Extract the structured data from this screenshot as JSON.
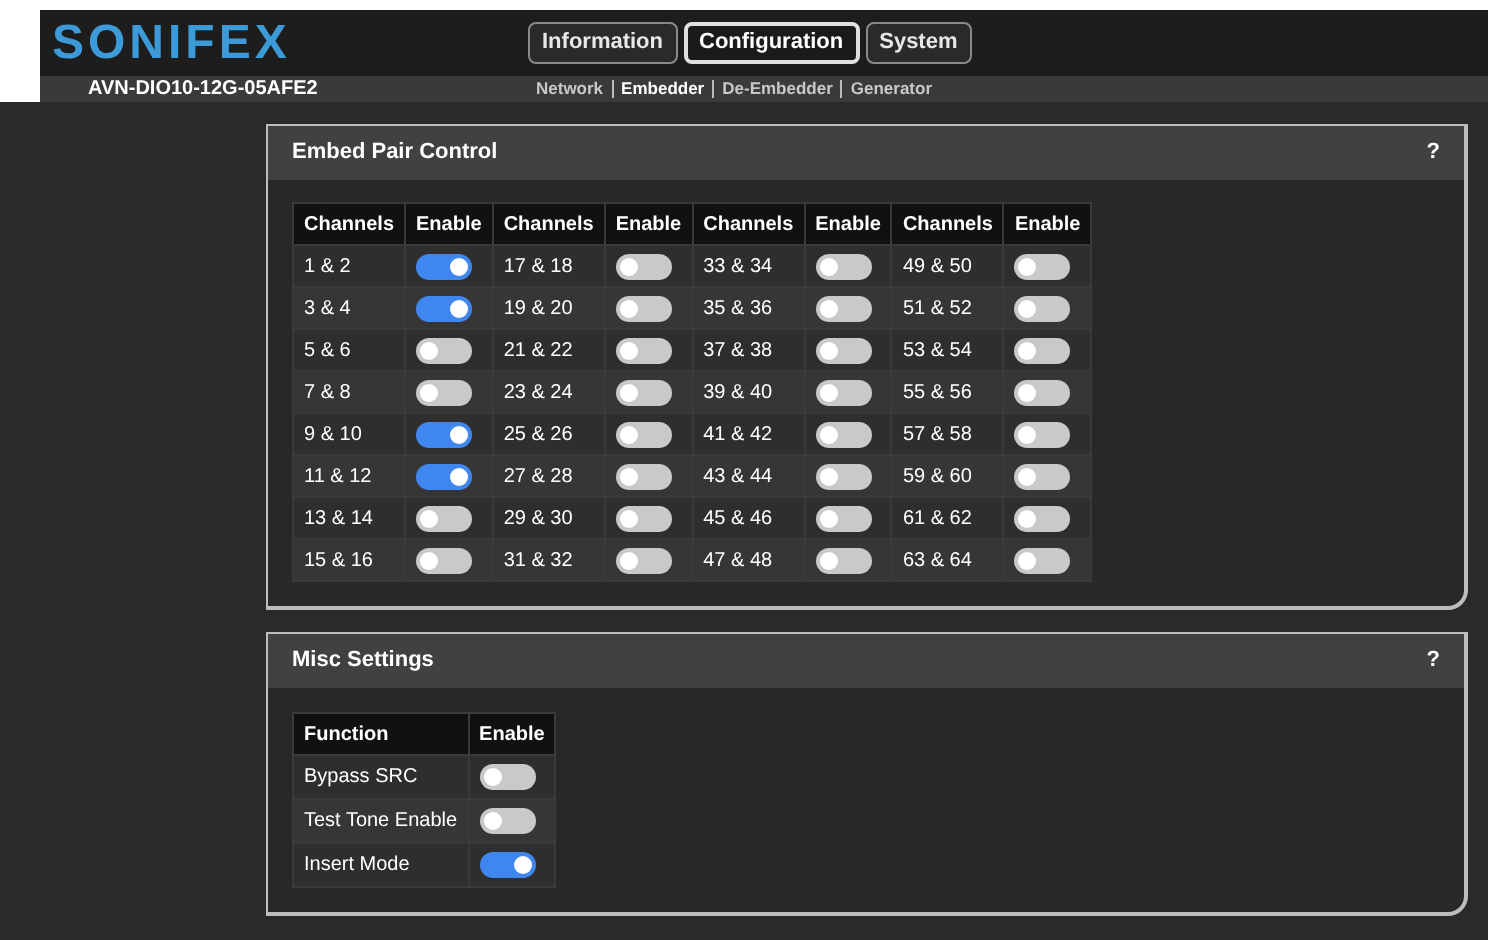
{
  "header": {
    "logo": "SONIFEX",
    "tabs": [
      {
        "label": "Information",
        "selected": false
      },
      {
        "label": "Configuration",
        "selected": true
      },
      {
        "label": "System",
        "selected": false
      }
    ],
    "device": "AVN-DIO10-12G-05AFE2",
    "subnav": [
      {
        "label": "Network",
        "selected": false
      },
      {
        "label": "Embedder",
        "selected": true
      },
      {
        "label": "De-Embedder",
        "selected": false
      },
      {
        "label": "Generator",
        "selected": false
      }
    ]
  },
  "embed_panel": {
    "title": "Embed Pair Control",
    "help": "?",
    "columns": [
      "Channels",
      "Enable",
      "Channels",
      "Enable",
      "Channels",
      "Enable",
      "Channels",
      "Enable"
    ],
    "pairs": [
      {
        "channels": "1 & 2",
        "on": true
      },
      {
        "channels": "3 & 4",
        "on": true
      },
      {
        "channels": "5 & 6",
        "on": false
      },
      {
        "channels": "7 & 8",
        "on": false
      },
      {
        "channels": "9 & 10",
        "on": true
      },
      {
        "channels": "11 & 12",
        "on": true
      },
      {
        "channels": "13 & 14",
        "on": false
      },
      {
        "channels": "15 & 16",
        "on": false
      },
      {
        "channels": "17 & 18",
        "on": false
      },
      {
        "channels": "19 & 20",
        "on": false
      },
      {
        "channels": "21 & 22",
        "on": false
      },
      {
        "channels": "23 & 24",
        "on": false
      },
      {
        "channels": "25 & 26",
        "on": false
      },
      {
        "channels": "27 & 28",
        "on": false
      },
      {
        "channels": "29 & 30",
        "on": false
      },
      {
        "channels": "31 & 32",
        "on": false
      },
      {
        "channels": "33 & 34",
        "on": false
      },
      {
        "channels": "35 & 36",
        "on": false
      },
      {
        "channels": "37 & 38",
        "on": false
      },
      {
        "channels": "39 & 40",
        "on": false
      },
      {
        "channels": "41 & 42",
        "on": false
      },
      {
        "channels": "43 & 44",
        "on": false
      },
      {
        "channels": "45 & 46",
        "on": false
      },
      {
        "channels": "47 & 48",
        "on": false
      },
      {
        "channels": "49 & 50",
        "on": false
      },
      {
        "channels": "51 & 52",
        "on": false
      },
      {
        "channels": "53 & 54",
        "on": false
      },
      {
        "channels": "55 & 56",
        "on": false
      },
      {
        "channels": "57 & 58",
        "on": false
      },
      {
        "channels": "59 & 60",
        "on": false
      },
      {
        "channels": "61 & 62",
        "on": false
      },
      {
        "channels": "63 & 64",
        "on": false
      }
    ]
  },
  "misc_panel": {
    "title": "Misc Settings",
    "help": "?",
    "columns": [
      "Function",
      "Enable"
    ],
    "rows": [
      {
        "function": "Bypass SRC",
        "on": false
      },
      {
        "function": "Test Tone Enable",
        "on": false
      },
      {
        "function": "Insert Mode",
        "on": true
      }
    ]
  }
}
